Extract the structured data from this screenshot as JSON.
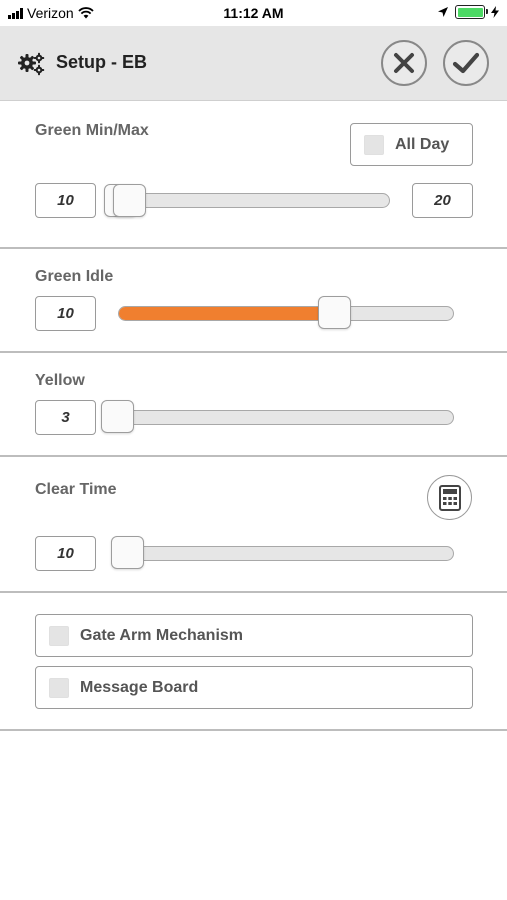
{
  "status_bar": {
    "carrier": "Verizon",
    "time": "11:12 AM",
    "battery_level": 1.0
  },
  "header": {
    "title": "Setup - EB",
    "icons": {
      "settings": "gears-icon",
      "cancel": "x-icon",
      "confirm": "checkmark-icon"
    }
  },
  "green_minmax": {
    "label": "Green Min/Max",
    "all_day_label": "All Day",
    "all_day_checked": false,
    "min_value": "10",
    "max_value": "20"
  },
  "green_idle": {
    "label": "Green Idle",
    "value": "10",
    "slider_level": 0.66,
    "fill_color": "#f07f2f"
  },
  "yellow": {
    "label": "Yellow",
    "value": "3",
    "slider_level": 0.0
  },
  "clear_time": {
    "label": "Clear Time",
    "value": "10",
    "slider_level": 0.0,
    "calculator_icon": "calculator-icon"
  },
  "options": [
    {
      "label": "Gate Arm Mechanism",
      "checked": false
    },
    {
      "label": "Message Board",
      "checked": false
    }
  ]
}
